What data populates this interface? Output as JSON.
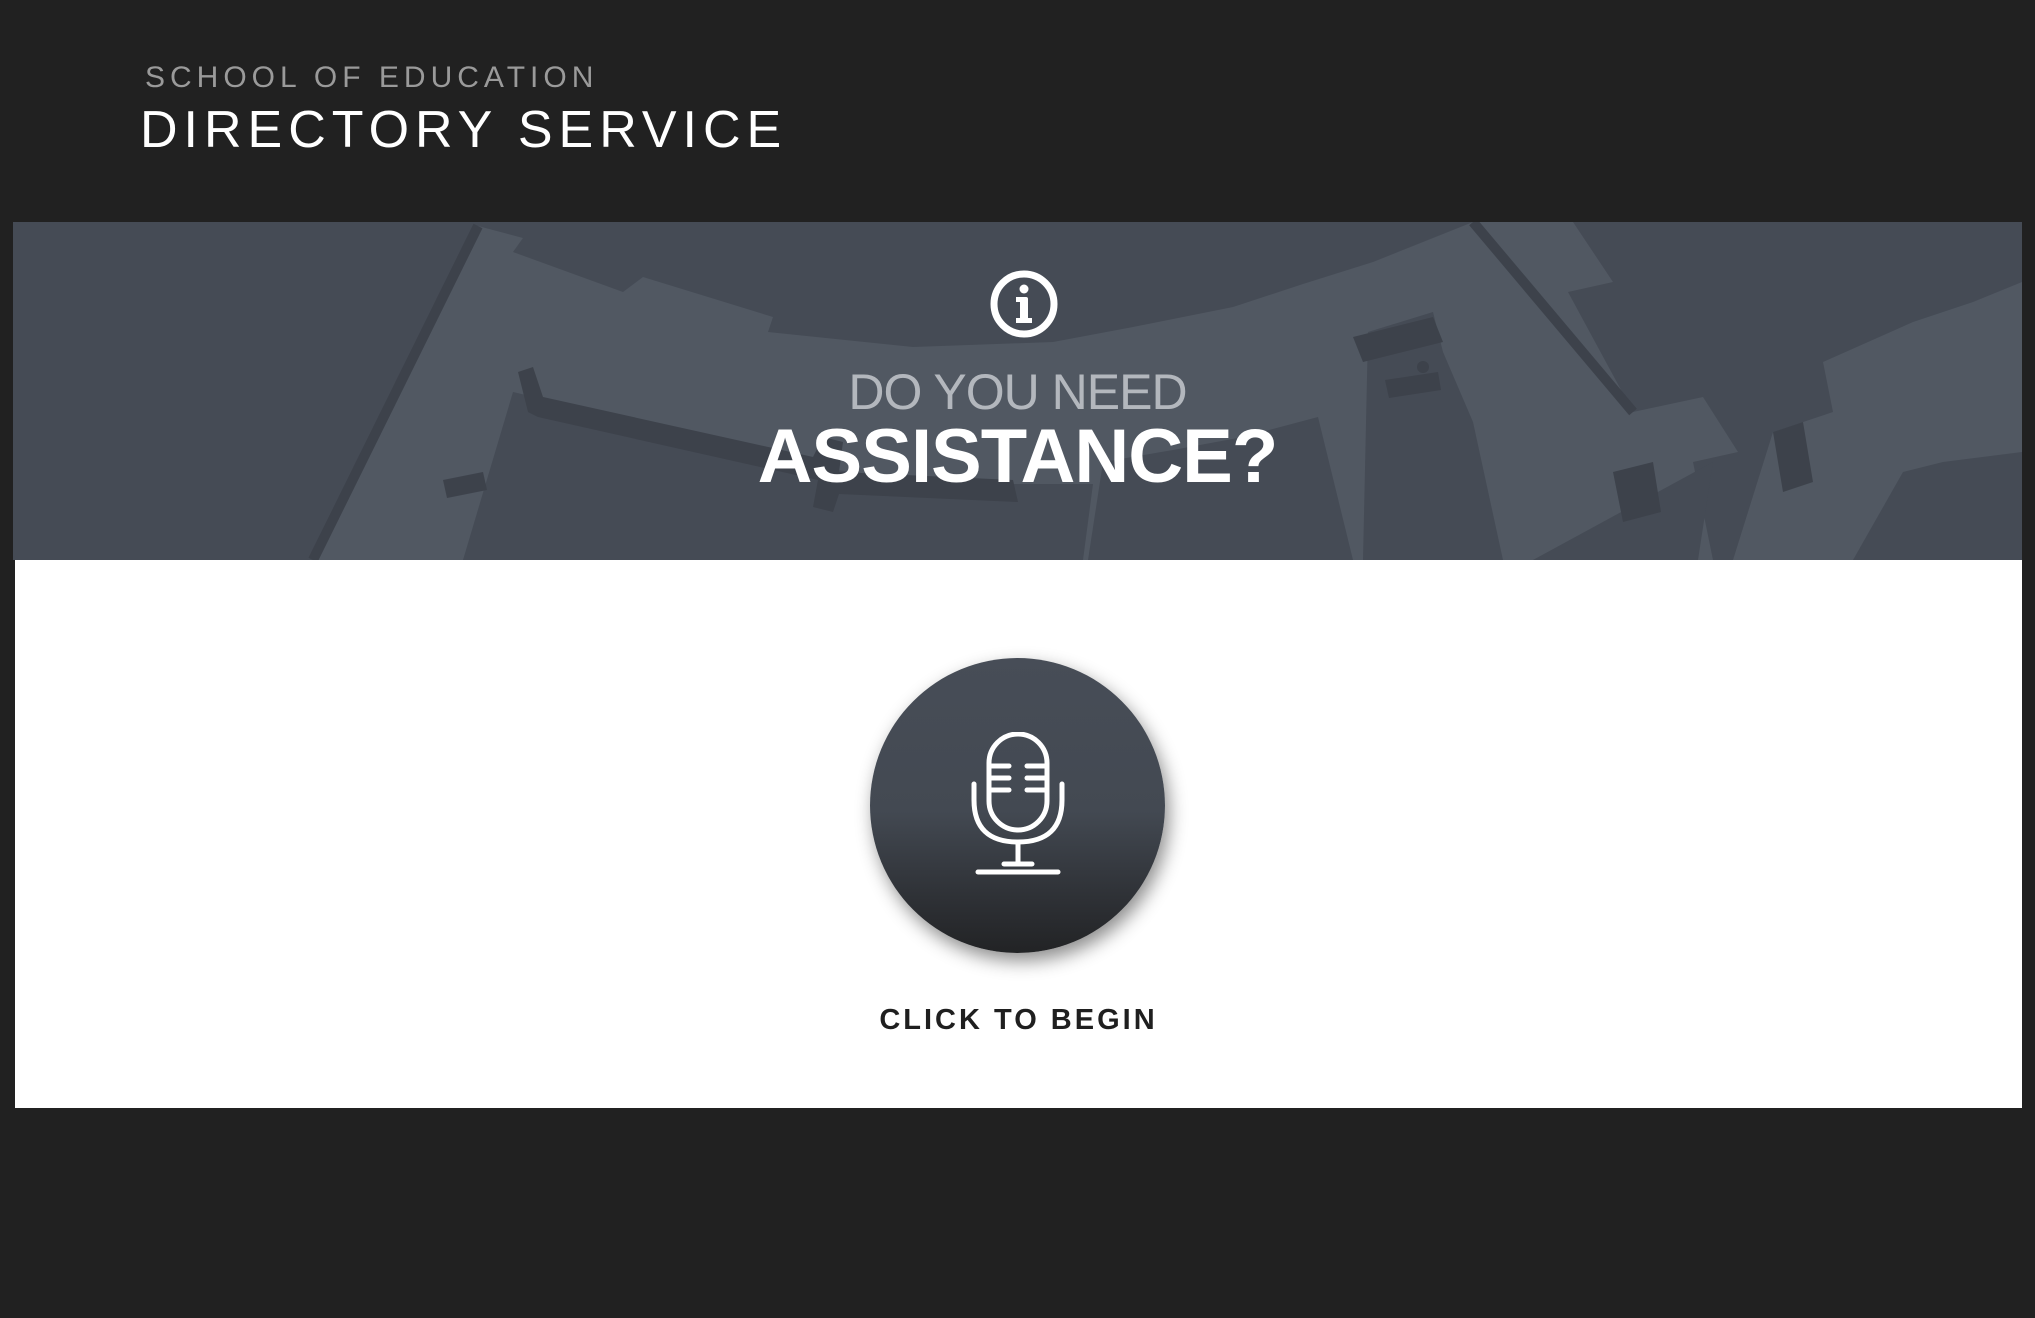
{
  "header": {
    "org_name": "SCHOOL OF EDUCATION",
    "app_title": "DIRECTORY SERVICE"
  },
  "banner": {
    "icon": "info-icon",
    "question_line1": "DO YOU NEED",
    "question_line2": "ASSISTANCE?",
    "background": "campus-map"
  },
  "assist": {
    "button_icon": "microphone-icon",
    "button_label": "CLICK TO BEGIN"
  },
  "colors": {
    "page_background": "#212121",
    "banner_background": "#454b55",
    "panel_background": "#ffffff",
    "button_top": "#474d57",
    "button_bottom": "#222325"
  }
}
